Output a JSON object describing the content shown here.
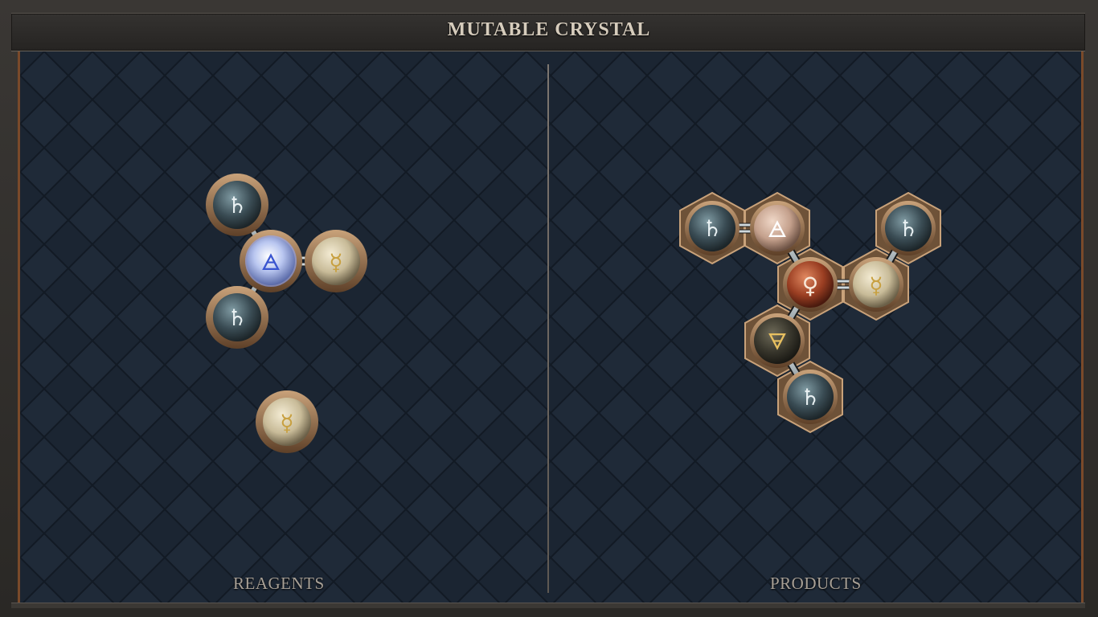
{
  "title": "MUTABLE CRYSTAL",
  "panels": {
    "left_label": "REAGENTS",
    "right_label": "PRODUCTS"
  },
  "colors": {
    "board": "#1b2532",
    "bronze": "#8a6a48",
    "accent_frame": "#7a4a2a"
  },
  "atom_symbols": {
    "lead": "♄",
    "air": "🜁",
    "quicksilver": "☿",
    "copper": "♀",
    "earth": "🜃"
  },
  "reagents": [
    {
      "element": "lead",
      "icon": "lead-atom-icon"
    },
    {
      "element": "lead",
      "icon": "lead-atom-icon"
    },
    {
      "element": "air",
      "icon": "air-atom-icon"
    },
    {
      "element": "quicksilver",
      "icon": "quicksilver-atom-icon"
    },
    {
      "element": "quicksilver",
      "icon": "quicksilver-atom-icon"
    }
  ],
  "products": [
    {
      "element": "lead",
      "icon": "lead-atom-icon"
    },
    {
      "element": "air",
      "icon": "air-atom-icon"
    },
    {
      "element": "lead",
      "icon": "lead-atom-icon"
    },
    {
      "element": "copper",
      "icon": "copper-atom-icon"
    },
    {
      "element": "quicksilver",
      "icon": "quicksilver-atom-icon"
    },
    {
      "element": "earth",
      "icon": "earth-atom-icon"
    },
    {
      "element": "lead",
      "icon": "lead-atom-icon"
    }
  ]
}
